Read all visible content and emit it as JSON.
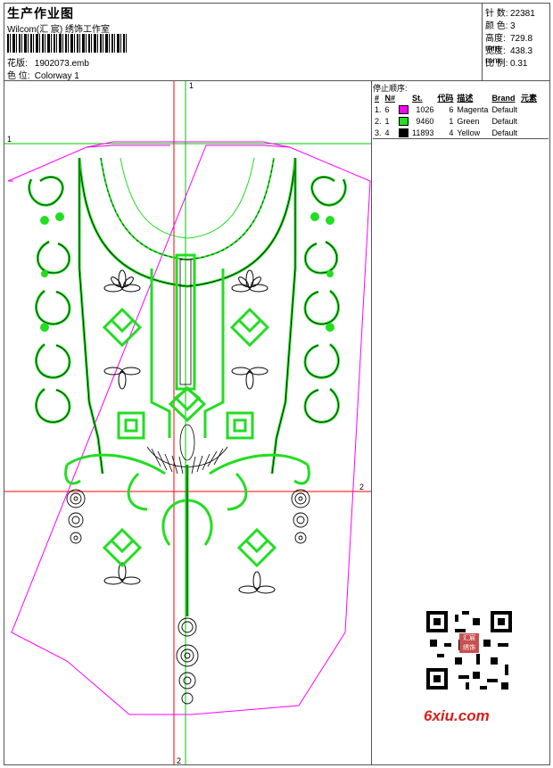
{
  "header": {
    "title": "生产作业图",
    "company": "Wilcom(汇 宸) 绣饰工作室",
    "design_label": "花版:",
    "design_value": "1902073.emb",
    "colorway_label": "色 位:",
    "colorway_value": "Colorway 1"
  },
  "stats": [
    {
      "label": "针 数:",
      "value": "22381"
    },
    {
      "label": "颜 色:",
      "value": "3"
    },
    {
      "label": "高度:",
      "value": "729.8 mm"
    },
    {
      "label": "宽度:",
      "value": "438.3 mm"
    },
    {
      "label": "比 例:",
      "value": "0.31"
    }
  ],
  "stop_sequence": {
    "title": "停止顺序:",
    "columns": [
      "#",
      "N#",
      "St.",
      "代码",
      "描述",
      "Brand",
      "元素"
    ],
    "rows": [
      {
        "n": "1.",
        "nn": "6",
        "color": "#ff00ff",
        "st": "1026",
        "code": "6",
        "desc": "Magenta",
        "brand": "Default"
      },
      {
        "n": "2.",
        "nn": "1",
        "color": "#22dd22",
        "st": "9460",
        "code": "1",
        "desc": "Green",
        "brand": "Default"
      },
      {
        "n": "3.",
        "nn": "4",
        "color": "#000000",
        "st": "11893",
        "code": "4",
        "desc": "Yellow",
        "brand": "Default"
      }
    ]
  },
  "guides": {
    "v_top": "1",
    "h_left": "1",
    "h_right": "2",
    "v_bottom": "2"
  },
  "watermark": {
    "site": "6xiu.com",
    "stamp": "汇宸 绣饰"
  },
  "colors": {
    "magenta": "#ff00ff",
    "green": "#22dd22",
    "guide_green": "#00c800",
    "guide_red": "#ff0000"
  }
}
